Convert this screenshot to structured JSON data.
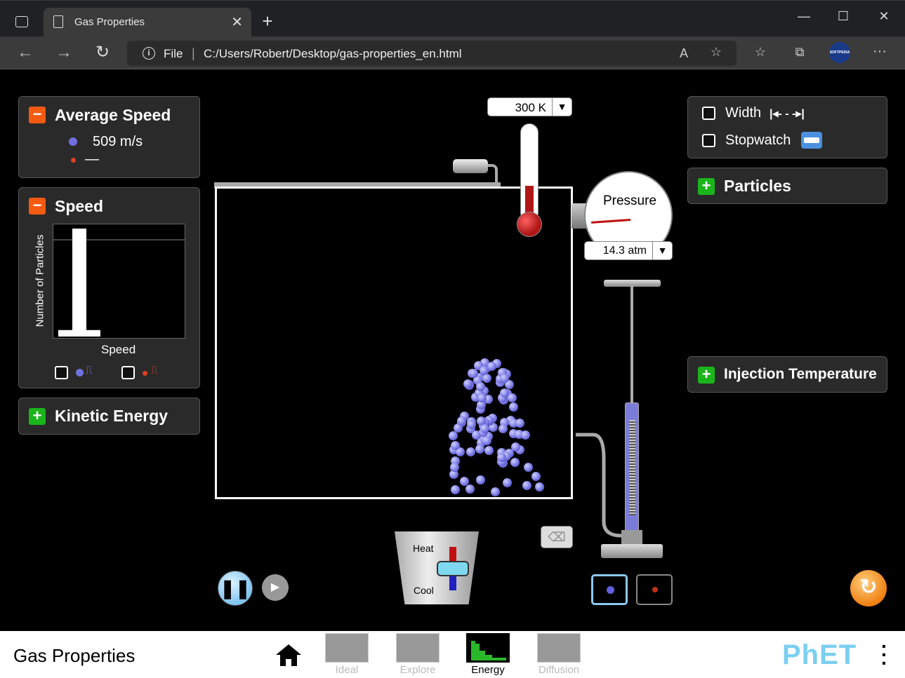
{
  "browser": {
    "tab_title": "Gas Properties",
    "tab_close": "✕",
    "new_tab": "+",
    "minimize": "—",
    "maximize": "☐",
    "close": "✕",
    "back": "←",
    "forward": "→",
    "reload": "↻",
    "address_scheme": "File",
    "address_url": "C:/Users/Robert/Desktop/gas-properties_en.html",
    "profile_label": "SOFTPEDIA",
    "menu": "···"
  },
  "panels": {
    "average_speed": {
      "title": "Average Speed",
      "heavy_value": "509 m/s",
      "light_value": "—"
    },
    "speed": {
      "title": "Speed",
      "ylabel": "Number of Particles",
      "xlabel": "Speed"
    },
    "kinetic_energy": {
      "title": "Kinetic Energy"
    },
    "tools": {
      "width_label": "Width",
      "width_icon_text": "|◂- - -▸|",
      "stopwatch_label": "Stopwatch"
    },
    "particles": {
      "title": "Particles"
    },
    "injection_temperature": {
      "title": "Injection Temperature"
    }
  },
  "instruments": {
    "temperature": "300 K",
    "pressure_label": "Pressure",
    "pressure": "14.3 atm",
    "dropdown_arrow": "▼",
    "heat_label": "Heat",
    "cool_label": "Cool"
  },
  "controls": {
    "pause": "❚❚",
    "step": "▶",
    "reset": "↻"
  },
  "chart_data": {
    "type": "bar",
    "xlabel": "Speed",
    "ylabel": "Number of Particles",
    "values": [
      6,
      100,
      6,
      0,
      0,
      0,
      0,
      0
    ],
    "colors": {
      "heavy": "#6060e0",
      "light": "#c03018",
      "bars": "#ffffff"
    }
  },
  "navbar": {
    "sim_title": "Gas Properties",
    "screens": [
      {
        "label": "Ideal"
      },
      {
        "label": "Explore"
      },
      {
        "label": "Energy"
      },
      {
        "label": "Diffusion"
      }
    ],
    "brand": "PhET"
  }
}
